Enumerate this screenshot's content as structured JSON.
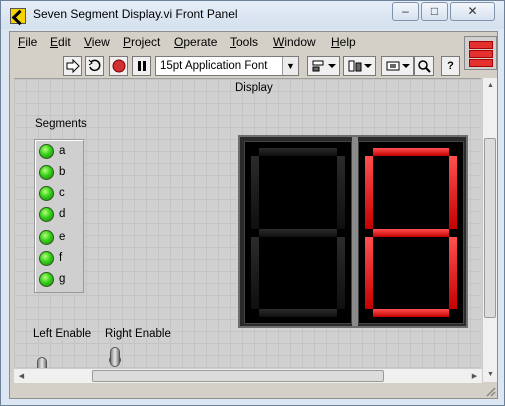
{
  "window": {
    "title": "Seven Segment Display.vi Front Panel",
    "controls": {
      "minimize": "–",
      "maximize": "□",
      "close": "✕"
    }
  },
  "menu": {
    "items": [
      {
        "label": "File",
        "mnemonic": "F",
        "rest": "ile"
      },
      {
        "label": "Edit",
        "mnemonic": "E",
        "rest": "dit"
      },
      {
        "label": "View",
        "mnemonic": "V",
        "rest": "iew"
      },
      {
        "label": "Project",
        "mnemonic": "P",
        "rest": "roject"
      },
      {
        "label": "Operate",
        "mnemonic": "O",
        "rest": "perate"
      },
      {
        "label": "Tools",
        "mnemonic": "T",
        "rest": "ools"
      },
      {
        "label": "Window",
        "mnemonic": "W",
        "rest": "indow"
      },
      {
        "label": "Help",
        "mnemonic": "H",
        "rest": "elp"
      }
    ]
  },
  "toolbar": {
    "run_icon": "run-arrow-icon",
    "run_continuous_icon": "run-continuously-icon",
    "abort_icon": "abort-icon",
    "pause_icon": "pause-icon",
    "font_selector": "15pt Application Font",
    "align_icon": "align-objects-icon",
    "distribute_icon": "distribute-objects-icon",
    "resize_icon": "resize-objects-icon",
    "search_icon": "search-icon",
    "help_icon": "context-help-icon",
    "help_glyph": "?"
  },
  "panel": {
    "segments_label": "Segments",
    "leds": [
      "a",
      "b",
      "c",
      "d",
      "e",
      "f",
      "g"
    ],
    "display_label": "Display",
    "left_enable_label": "Left Enable",
    "right_enable_label": "Right Enable",
    "left_digit": {
      "enabled": false,
      "lit_segments": []
    },
    "right_digit": {
      "enabled": true,
      "lit_segments": [
        "a",
        "b",
        "c",
        "d",
        "e",
        "f",
        "g"
      ]
    }
  },
  "colors": {
    "led_on": "#36d11a",
    "segment_on": "#e00000",
    "segment_off": "#1c1c1c"
  }
}
